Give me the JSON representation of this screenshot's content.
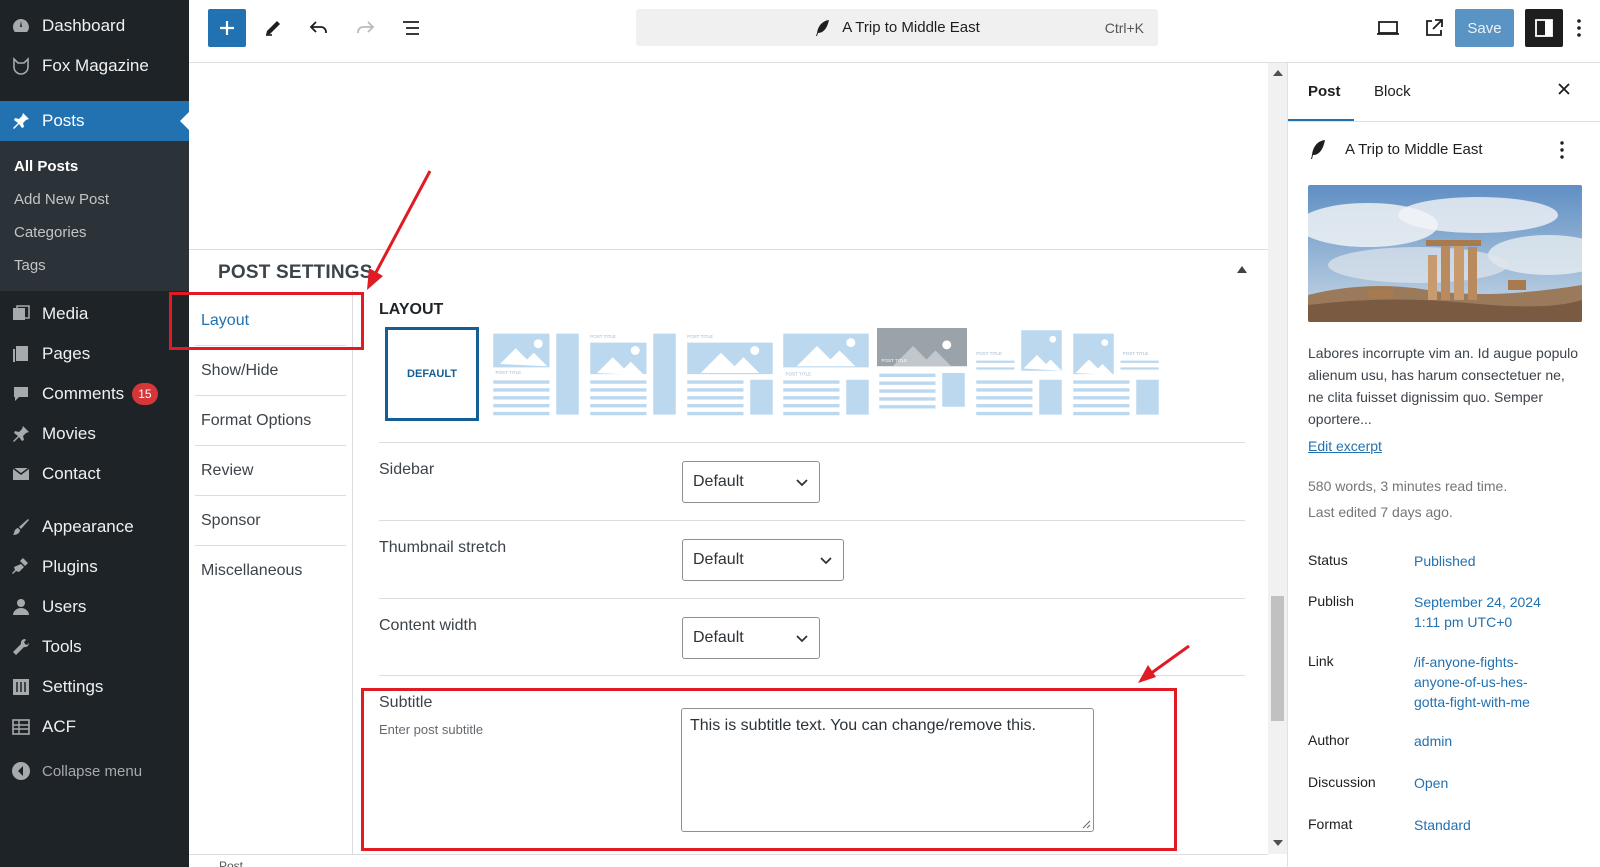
{
  "admin_menu": {
    "dashboard": "Dashboard",
    "site_name": "Fox Magazine",
    "posts": "Posts",
    "posts_submenu": [
      "All Posts",
      "Add New Post",
      "Categories",
      "Tags"
    ],
    "media": "Media",
    "pages": "Pages",
    "comments": "Comments",
    "comments_count": "15",
    "movies": "Movies",
    "contact": "Contact",
    "appearance": "Appearance",
    "plugins": "Plugins",
    "users": "Users",
    "tools": "Tools",
    "settings": "Settings",
    "acf": "ACF",
    "collapse": "Collapse menu"
  },
  "toolbar": {
    "document_title": "A Trip to Middle East",
    "shortcut": "Ctrl+K",
    "save_label": "Save"
  },
  "post_settings": {
    "title": "POST SETTINGS",
    "tabs": [
      "Layout",
      "Show/Hide",
      "Format Options",
      "Review",
      "Sponsor",
      "Miscellaneous"
    ],
    "layout_label": "LAYOUT",
    "default_layout_label": "DEFAULT",
    "thumb_caption": "POST TITLE",
    "fields": {
      "sidebar": {
        "label": "Sidebar",
        "value": "Default"
      },
      "thumbnail_stretch": {
        "label": "Thumbnail stretch",
        "value": "Default"
      },
      "content_width": {
        "label": "Content width",
        "value": "Default"
      },
      "subtitle": {
        "label": "Subtitle",
        "description": "Enter post subtitle",
        "value": "This is subtitle text. You can change/remove this."
      }
    }
  },
  "footer": {
    "breadcrumb": "Post"
  },
  "inspector": {
    "tab_post": "Post",
    "tab_block": "Block",
    "post_title": "A Trip to Middle East",
    "excerpt": "Labores incorrupte vim an. Id augue populo alienum usu, has harum consectetuer ne, ne clita fuisset dignissim quo. Semper oportere...",
    "edit_excerpt": "Edit excerpt",
    "word_count": "580 words, 3 minutes read time.",
    "last_edited": "Last edited 7 days ago.",
    "rows": {
      "status_label": "Status",
      "status_value": "Published",
      "publish_label": "Publish",
      "publish_value_line1": "September 24, 2024",
      "publish_value_line2": "1:11 pm UTC+0",
      "link_label": "Link",
      "link_value_line1": "/if-anyone-fights-",
      "link_value_line2": "anyone-of-us-hes-",
      "link_value_line3": "gotta-fight-with-me",
      "author_label": "Author",
      "author_value": "admin",
      "discussion_label": "Discussion",
      "discussion_value": "Open",
      "format_label": "Format",
      "format_value": "Standard"
    }
  },
  "colors": {
    "admin_bg": "#1d2327",
    "accent": "#2271b1",
    "annotation_red": "#e01b24"
  }
}
